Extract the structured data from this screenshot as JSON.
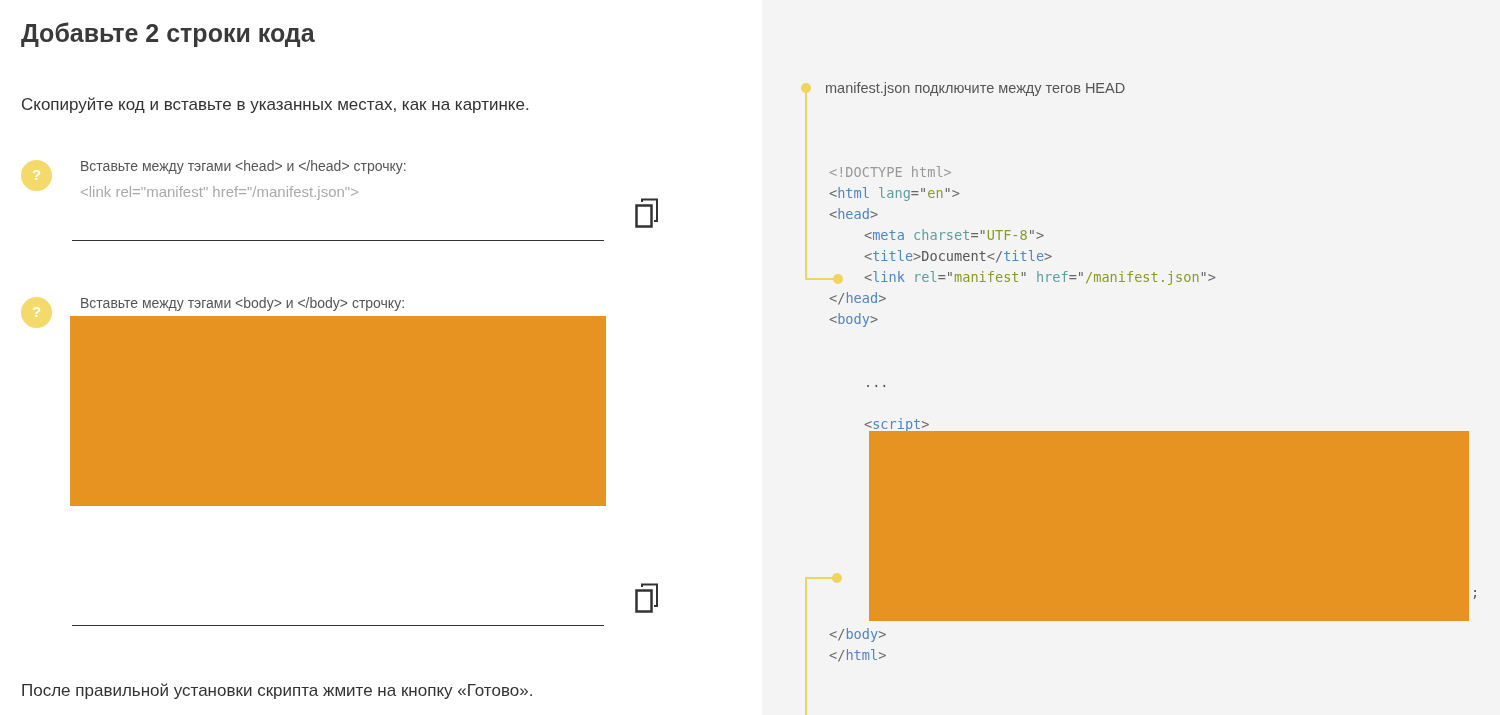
{
  "heading": "Добавьте 2 строки кода",
  "intro": "Скопируйте код и вставьте в указанных местах, как на картинке.",
  "steps": [
    {
      "help": "?",
      "label": "Вставьте между тэгами <head> и </head> строчку:",
      "placeholder": "<link rel=\"manifest\" href=\"/manifest.json\">",
      "redacted": false
    },
    {
      "help": "?",
      "label": "Вставьте между тэгами <body> и </body> строчку:",
      "redacted": true
    }
  ],
  "footer": "После правильной установки скрипта жмите на кнопку «Готово».",
  "note": "manifest.json подключите между тегов HEAD",
  "code_lines": [
    {
      "kind": "code",
      "tokens": [
        {
          "kind": "doctype",
          "text": "<!DOCTYPE html>"
        }
      ]
    },
    {
      "kind": "code",
      "tokens": [
        {
          "kind": "punct",
          "text": "<"
        },
        {
          "kind": "tag",
          "text": "html"
        },
        {
          "kind": "attr",
          "text": " lang"
        },
        {
          "kind": "punct",
          "text": "=\""
        },
        {
          "kind": "string",
          "text": "en"
        },
        {
          "kind": "punct",
          "text": "\">"
        }
      ]
    },
    {
      "kind": "code",
      "tokens": [
        {
          "kind": "punct",
          "text": "<"
        },
        {
          "kind": "tag",
          "text": "head"
        },
        {
          "kind": "punct",
          "text": ">"
        }
      ],
      "children": [
        {
          "kind": "code",
          "tokens": [
            {
              "kind": "punct",
              "text": "<"
            },
            {
              "kind": "tag",
              "text": "meta"
            },
            {
              "kind": "attr",
              "text": " charset"
            },
            {
              "kind": "punct",
              "text": "=\""
            },
            {
              "kind": "string",
              "text": "UTF-8"
            },
            {
              "kind": "punct",
              "text": "\">"
            }
          ]
        },
        {
          "kind": "code",
          "tokens": [
            {
              "kind": "punct",
              "text": "<"
            },
            {
              "kind": "tag",
              "text": "title"
            },
            {
              "kind": "punct",
              "text": ">"
            },
            {
              "kind": "text",
              "text": "Document"
            },
            {
              "kind": "punct",
              "text": "</"
            },
            {
              "kind": "tag",
              "text": "title"
            },
            {
              "kind": "punct",
              "text": ">"
            }
          ]
        },
        {
          "kind": "code",
          "tokens": [
            {
              "kind": "punct",
              "text": "<"
            },
            {
              "kind": "tag",
              "text": "link"
            },
            {
              "kind": "attr",
              "text": " rel"
            },
            {
              "kind": "punct",
              "text": "=\""
            },
            {
              "kind": "string",
              "text": "manifest"
            },
            {
              "kind": "punct",
              "text": "\""
            },
            {
              "kind": "attr",
              "text": " href"
            },
            {
              "kind": "punct",
              "text": "=\""
            },
            {
              "kind": "string",
              "text": "/manifest.json"
            },
            {
              "kind": "punct",
              "text": "\">"
            }
          ]
        }
      ]
    },
    {
      "kind": "code",
      "tokens": [
        {
          "kind": "punct",
          "text": "</"
        },
        {
          "kind": "tag",
          "text": "head"
        },
        {
          "kind": "punct",
          "text": ">"
        }
      ]
    },
    {
      "kind": "code",
      "tokens": [
        {
          "kind": "punct",
          "text": "<"
        },
        {
          "kind": "tag",
          "text": "body"
        },
        {
          "kind": "punct",
          "text": ">"
        }
      ],
      "children": [
        {
          "kind": "blank"
        },
        {
          "kind": "blank"
        },
        {
          "kind": "code",
          "tokens": [
            {
              "kind": "text",
              "text": "..."
            }
          ]
        },
        {
          "kind": "blank"
        },
        {
          "kind": "code",
          "tokens": [
            {
              "kind": "punct",
              "text": "<"
            },
            {
              "kind": "tag",
              "text": "script"
            },
            {
              "kind": "punct",
              "text": ">"
            }
          ]
        },
        {
          "kind": "blank"
        },
        {
          "kind": "blank"
        },
        {
          "kind": "blank"
        },
        {
          "kind": "blank"
        },
        {
          "kind": "blank"
        },
        {
          "kind": "blank"
        },
        {
          "kind": "blank"
        },
        {
          "kind": "trail",
          "text": ";"
        },
        {
          "kind": "blank"
        }
      ]
    },
    {
      "kind": "code",
      "tokens": [
        {
          "kind": "punct",
          "text": "</"
        },
        {
          "kind": "tag",
          "text": "body"
        },
        {
          "kind": "punct",
          "text": ">"
        }
      ]
    },
    {
      "kind": "code",
      "tokens": [
        {
          "kind": "punct",
          "text": "</"
        },
        {
          "kind": "tag",
          "text": "html"
        },
        {
          "kind": "punct",
          "text": ">"
        }
      ]
    }
  ],
  "code_redacted": true
}
